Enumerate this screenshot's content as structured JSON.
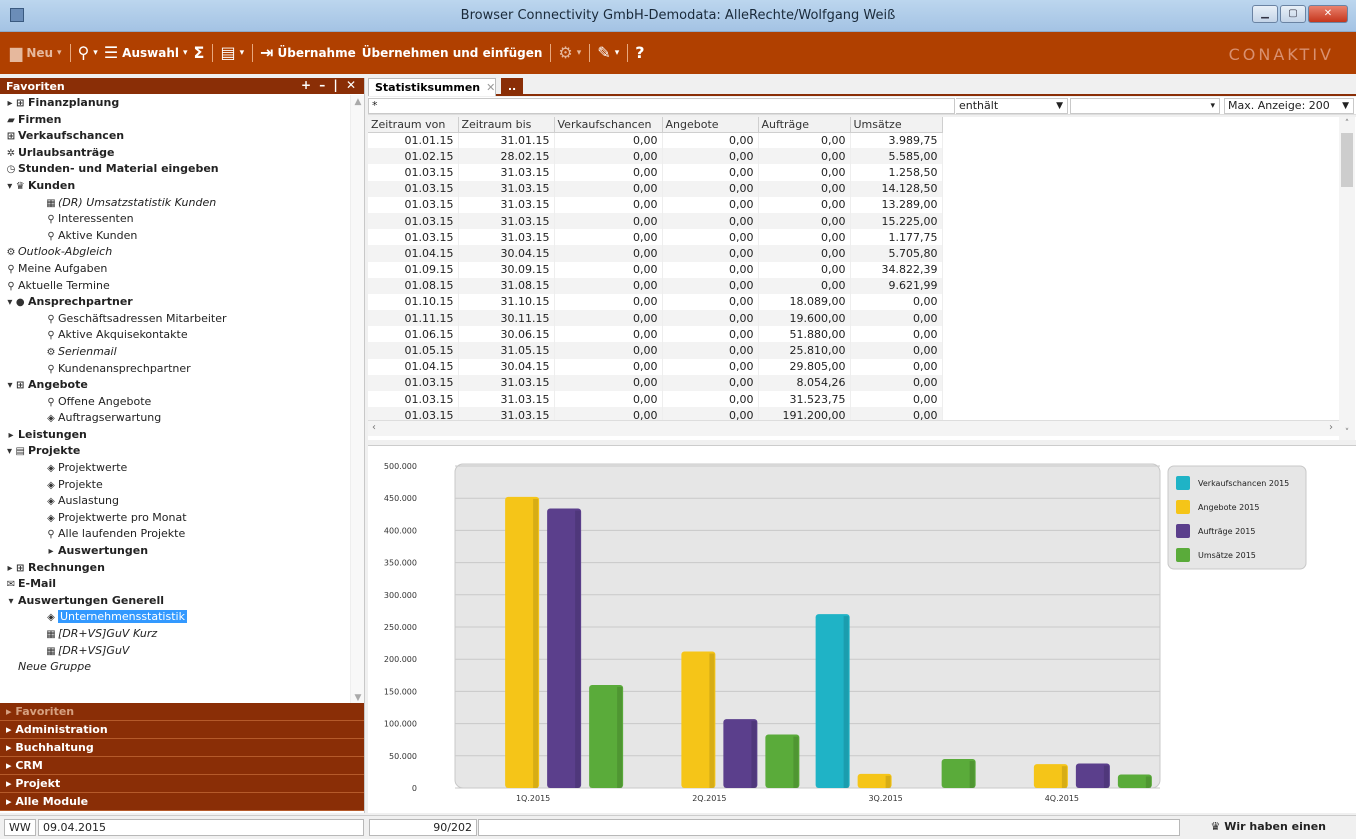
{
  "window": {
    "title": "Browser  Connectivity GmbH-Demodata: AlleRechte/Wolfgang Weiß"
  },
  "toolbar": {
    "new_label": "Neu",
    "select_label": "Auswahl",
    "take_label": "Übernahme",
    "take_insert_label": "Übernehmen und einfügen",
    "help_label": "?",
    "logo": "CONAKTIV"
  },
  "favorites_header": {
    "title": "Favoriten",
    "controls": "+ – | ✕"
  },
  "tree": [
    {
      "label": "Finanzplanung",
      "icon": "▸ ⊞",
      "style": "bold",
      "indent": 0
    },
    {
      "label": "Firmen",
      "icon": "▰",
      "style": "bold",
      "indent": 0
    },
    {
      "label": "Verkaufschancen",
      "icon": "⊞",
      "style": "bold",
      "indent": 0
    },
    {
      "label": "Urlaubsanträge",
      "icon": "✲",
      "style": "bold",
      "indent": 0
    },
    {
      "label": "Stunden- und Material eingeben",
      "icon": "◷",
      "style": "bold",
      "indent": 0
    },
    {
      "label": "Kunden",
      "icon": "▾ ♛",
      "style": "bold",
      "indent": 0
    },
    {
      "label": "(DR) Umsatzstatistik Kunden",
      "icon": "▦",
      "style": "italic",
      "indent": 1
    },
    {
      "label": "Interessenten",
      "icon": "⚲",
      "style": "normal",
      "indent": 1
    },
    {
      "label": "Aktive Kunden",
      "icon": "⚲",
      "style": "normal",
      "indent": 1
    },
    {
      "label": "Outlook-Abgleich",
      "icon": "⚙",
      "style": "italic",
      "indent": 0
    },
    {
      "label": "Meine Aufgaben",
      "icon": "⚲",
      "style": "normal",
      "indent": 0
    },
    {
      "label": "Aktuelle Termine",
      "icon": "⚲",
      "style": "normal",
      "indent": 0
    },
    {
      "label": "Ansprechpartner",
      "icon": "▾ ●",
      "style": "bold",
      "indent": 0
    },
    {
      "label": "Geschäftsadressen Mitarbeiter",
      "icon": "⚲",
      "style": "normal",
      "indent": 1
    },
    {
      "label": "Aktive Akquisekontakte",
      "icon": "⚲",
      "style": "normal",
      "indent": 1
    },
    {
      "label": "Serienmail",
      "icon": "⚙",
      "style": "italic",
      "indent": 1
    },
    {
      "label": "Kundenansprechpartner",
      "icon": "⚲",
      "style": "normal",
      "indent": 1
    },
    {
      "label": "Angebote",
      "icon": "▾ ⊞",
      "style": "bold",
      "indent": 0
    },
    {
      "label": "Offene Angebote",
      "icon": "⚲",
      "style": "normal",
      "indent": 1
    },
    {
      "label": "Auftragserwartung",
      "icon": "◈",
      "style": "normal",
      "indent": 1
    },
    {
      "label": "Leistungen",
      "icon": "▸",
      "style": "bold",
      "indent": 0
    },
    {
      "label": "Projekte",
      "icon": "▾ ▤",
      "style": "bold",
      "indent": 0
    },
    {
      "label": "Projektwerte",
      "icon": "◈",
      "style": "normal",
      "indent": 1
    },
    {
      "label": "Projekte",
      "icon": "◈",
      "style": "normal",
      "indent": 1
    },
    {
      "label": "Auslastung",
      "icon": "◈",
      "style": "normal",
      "indent": 1
    },
    {
      "label": "Projektwerte pro Monat",
      "icon": "◈",
      "style": "normal",
      "indent": 1
    },
    {
      "label": "Alle laufenden Projekte",
      "icon": "⚲",
      "style": "normal",
      "indent": 1
    },
    {
      "label": "Auswertungen",
      "icon": "▸",
      "style": "bold",
      "indent": 1
    },
    {
      "label": "Rechnungen",
      "icon": "▸ ⊞",
      "style": "bold",
      "indent": 0
    },
    {
      "label": "E-Mail",
      "icon": "✉",
      "style": "bold",
      "indent": 0
    },
    {
      "label": "Auswertungen Generell",
      "icon": "▾",
      "style": "bold",
      "indent": 0
    },
    {
      "label": "Unternehmensstatistik",
      "icon": "◈",
      "style": "selected",
      "indent": 1
    },
    {
      "label": "[DR+VS]GuV Kurz",
      "icon": "▦",
      "style": "italic",
      "indent": 1
    },
    {
      "label": "[DR+VS]GuV",
      "icon": "▦",
      "style": "italic",
      "indent": 1
    },
    {
      "label": "Neue Gruppe",
      "icon": "",
      "style": "italic",
      "indent": 0
    }
  ],
  "modules": [
    {
      "label": "Favoriten",
      "dim": true
    },
    {
      "label": "Administration",
      "dim": false
    },
    {
      "label": "Buchhaltung",
      "dim": false
    },
    {
      "label": "CRM",
      "dim": false
    },
    {
      "label": "Projekt",
      "dim": false
    },
    {
      "label": "Alle Module",
      "dim": false
    }
  ],
  "tabs": {
    "active_label": "Statistiksummen",
    "add_label": ".."
  },
  "filter": {
    "search_value": "*",
    "operator_value": "enthält",
    "max_display_value": "Max. Anzeige: 200"
  },
  "table": {
    "columns": [
      "Zeitraum von",
      "Zeitraum bis",
      "Verkaufschancen",
      "Angebote",
      "Aufträge",
      "Umsätze"
    ],
    "rows": [
      [
        "01.01.15",
        "31.01.15",
        "0,00",
        "0,00",
        "0,00",
        "3.989,75"
      ],
      [
        "01.02.15",
        "28.02.15",
        "0,00",
        "0,00",
        "0,00",
        "5.585,00"
      ],
      [
        "01.03.15",
        "31.03.15",
        "0,00",
        "0,00",
        "0,00",
        "1.258,50"
      ],
      [
        "01.03.15",
        "31.03.15",
        "0,00",
        "0,00",
        "0,00",
        "14.128,50"
      ],
      [
        "01.03.15",
        "31.03.15",
        "0,00",
        "0,00",
        "0,00",
        "13.289,00"
      ],
      [
        "01.03.15",
        "31.03.15",
        "0,00",
        "0,00",
        "0,00",
        "15.225,00"
      ],
      [
        "01.03.15",
        "31.03.15",
        "0,00",
        "0,00",
        "0,00",
        "1.177,75"
      ],
      [
        "01.04.15",
        "30.04.15",
        "0,00",
        "0,00",
        "0,00",
        "5.705,80"
      ],
      [
        "01.09.15",
        "30.09.15",
        "0,00",
        "0,00",
        "0,00",
        "34.822,39"
      ],
      [
        "01.08.15",
        "31.08.15",
        "0,00",
        "0,00",
        "0,00",
        "9.621,99"
      ],
      [
        "01.10.15",
        "31.10.15",
        "0,00",
        "0,00",
        "18.089,00",
        "0,00"
      ],
      [
        "01.11.15",
        "30.11.15",
        "0,00",
        "0,00",
        "19.600,00",
        "0,00"
      ],
      [
        "01.06.15",
        "30.06.15",
        "0,00",
        "0,00",
        "51.880,00",
        "0,00"
      ],
      [
        "01.05.15",
        "31.05.15",
        "0,00",
        "0,00",
        "25.810,00",
        "0,00"
      ],
      [
        "01.04.15",
        "30.04.15",
        "0,00",
        "0,00",
        "29.805,00",
        "0,00"
      ],
      [
        "01.03.15",
        "31.03.15",
        "0,00",
        "0,00",
        "8.054,26",
        "0,00"
      ],
      [
        "01.03.15",
        "31.03.15",
        "0,00",
        "0,00",
        "31.523,75",
        "0,00"
      ],
      [
        "01.03.15",
        "31.03.15",
        "0,00",
        "0,00",
        "191.200,00",
        "0,00"
      ]
    ]
  },
  "chart_data": {
    "type": "bar",
    "categories": [
      "1Q.2015",
      "2Q.2015",
      "3Q.2015",
      "4Q.2015"
    ],
    "series": [
      {
        "name": "Verkaufschancen 2015",
        "color": "#1fb3c6",
        "values": [
          0,
          0,
          270000,
          0
        ]
      },
      {
        "name": "Angebote 2015",
        "color": "#f5c518",
        "values": [
          452000,
          212000,
          22000,
          37000
        ]
      },
      {
        "name": "Aufträge 2015",
        "color": "#5b3f8c",
        "values": [
          434000,
          107000,
          0,
          38000
        ]
      },
      {
        "name": "Umsätze 2015",
        "color": "#5aab3a",
        "values": [
          160000,
          83000,
          45000,
          21000
        ]
      }
    ],
    "ylim": [
      0,
      500000
    ],
    "yticks": [
      "0",
      "50.000",
      "100.000",
      "150.000",
      "200.000",
      "250.000",
      "300.000",
      "350.000",
      "400.000",
      "450.000",
      "500.000"
    ],
    "legend": "right",
    "grid": true
  },
  "status": {
    "user": "WW",
    "date": "09.04.2015",
    "record_count": "90/202",
    "message": "Wir haben einen"
  }
}
